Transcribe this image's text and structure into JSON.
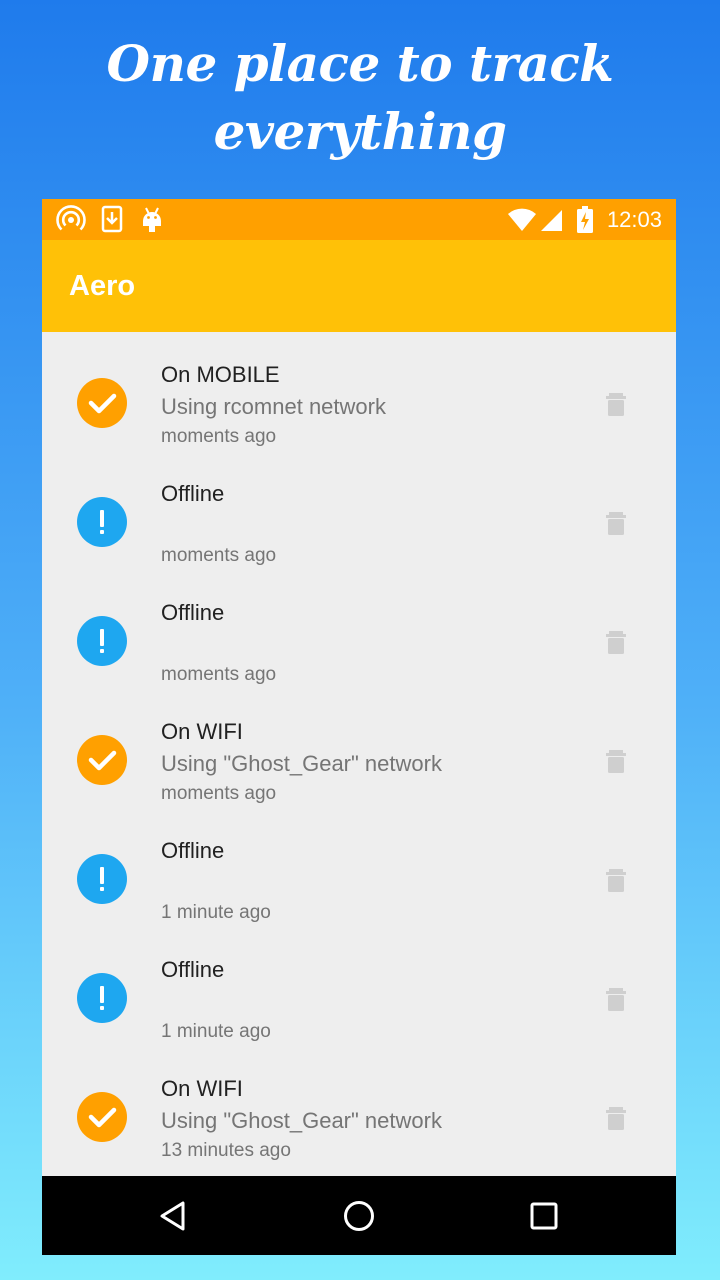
{
  "headline": {
    "line1": "One place to track",
    "line2": "everything"
  },
  "status_bar": {
    "left_icons": [
      "wireless-hotspot-icon",
      "download-icon",
      "android-icon"
    ],
    "right_icons": [
      "wifi-signal-icon",
      "cell-signal-icon",
      "battery-charging-icon"
    ],
    "time": "12:03",
    "color": "#ffa000"
  },
  "app_bar": {
    "title": "Aero",
    "color": "#ffc107"
  },
  "colors": {
    "online": "#ffa000",
    "offline": "#1ea7f0",
    "delete": "#cfcfcf"
  },
  "events": [
    {
      "status": "online",
      "icon": "check-icon",
      "title": "On MOBILE",
      "subtitle": "Using rcomnet network",
      "time": "moments ago"
    },
    {
      "status": "offline",
      "icon": "exclamation-icon",
      "title": "Offline",
      "subtitle": "",
      "time": "moments ago"
    },
    {
      "status": "offline",
      "icon": "exclamation-icon",
      "title": "Offline",
      "subtitle": "",
      "time": "moments ago"
    },
    {
      "status": "online",
      "icon": "check-icon",
      "title": "On WIFI",
      "subtitle": "Using \"Ghost_Gear\" network",
      "time": "moments ago"
    },
    {
      "status": "offline",
      "icon": "exclamation-icon",
      "title": "Offline",
      "subtitle": "",
      "time": "1 minute ago"
    },
    {
      "status": "offline",
      "icon": "exclamation-icon",
      "title": "Offline",
      "subtitle": "",
      "time": "1 minute ago"
    },
    {
      "status": "online",
      "icon": "check-icon",
      "title": "On WIFI",
      "subtitle": "Using \"Ghost_Gear\" network",
      "time": "13 minutes ago"
    }
  ],
  "nav_bar": {
    "buttons": [
      "back-icon",
      "home-icon",
      "recents-icon"
    ]
  }
}
